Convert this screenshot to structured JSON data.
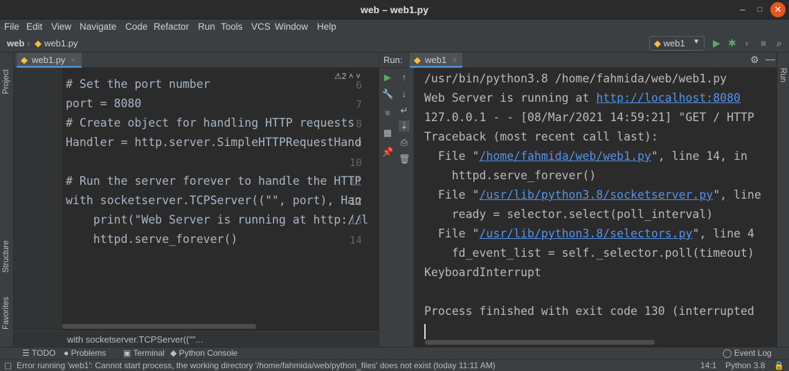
{
  "window": {
    "title": "web – web1.py",
    "buttons": [
      "–",
      "□",
      "✕"
    ]
  },
  "menu": [
    "File",
    "Edit",
    "View",
    "Navigate",
    "Code",
    "Refactor",
    "Run",
    "Tools",
    "VCS",
    "Window",
    "Help"
  ],
  "navbar": {
    "project": "web",
    "file": "web1.py",
    "run_config": "web1"
  },
  "left_stripe": [
    "Project",
    "Structure",
    "Favorites"
  ],
  "right_stripe": [
    "Run"
  ],
  "editor": {
    "tab": "web1.py",
    "warnings": "⚠2",
    "lines": [
      {
        "n": "6",
        "code": "# Set the port number"
      },
      {
        "n": "7",
        "code": "port = 8080"
      },
      {
        "n": "8",
        "code": "# Create object for handling HTTP requests"
      },
      {
        "n": "9",
        "code": "Handler = http.server.SimpleHTTPRequestHand"
      },
      {
        "n": "10",
        "code": ""
      },
      {
        "n": "11",
        "code": "# Run the server forever to handle the HTTP"
      },
      {
        "n": "12",
        "code": "with socketserver.TCPServer((\"\", port), Han"
      },
      {
        "n": "13",
        "code": "    print(\"Web Server is running at http://l"
      },
      {
        "n": "14",
        "code": "    httpd.serve_forever()"
      }
    ],
    "breadcrumb": "with socketserver.TCPServer((\"\"..."
  },
  "run": {
    "label": "Run:",
    "tab": "web1",
    "output": {
      "l1": "/usr/bin/python3.8 /home/fahmida/web/web1.py",
      "l2_prefix": "Web Server is running at ",
      "l2_link": "http://localhost:8080",
      "l3": "127.0.0.1 - - [08/Mar/2021 14:59:21] \"GET / HTTP",
      "l4": "Traceback (most recent call last):",
      "l5_prefix": "  File \"",
      "l5_link": "/home/fahmida/web/web1.py",
      "l5_suffix": "\", line 14, in",
      "l6": "    httpd.serve_forever()",
      "l7_prefix": "  File \"",
      "l7_link": "/usr/lib/python3.8/socketserver.py",
      "l7_suffix": "\", line",
      "l8": "    ready = selector.select(poll_interval)",
      "l9_prefix": "  File \"",
      "l9_link": "/usr/lib/python3.8/selectors.py",
      "l9_suffix": "\", line 4",
      "l10": "    fd_event_list = self._selector.poll(timeout)",
      "l11": "KeyboardInterrupt",
      "l13": "Process finished with exit code 130 (interrupted"
    }
  },
  "bottom_tools": {
    "todo": "TODO",
    "problems": "Problems",
    "terminal": "Terminal",
    "python_console": "Python Console",
    "event_log": "Event Log"
  },
  "status": {
    "message": "Error running 'web1': Cannot start process, the working directory '/home/fahmida/web/python_files' does not exist (today 11:11 AM)",
    "position": "14:1",
    "interpreter": "Python 3.8"
  },
  "colors": {
    "accent": "#4a88c7",
    "error": "#ff6b68",
    "close_button": "#e95420"
  }
}
